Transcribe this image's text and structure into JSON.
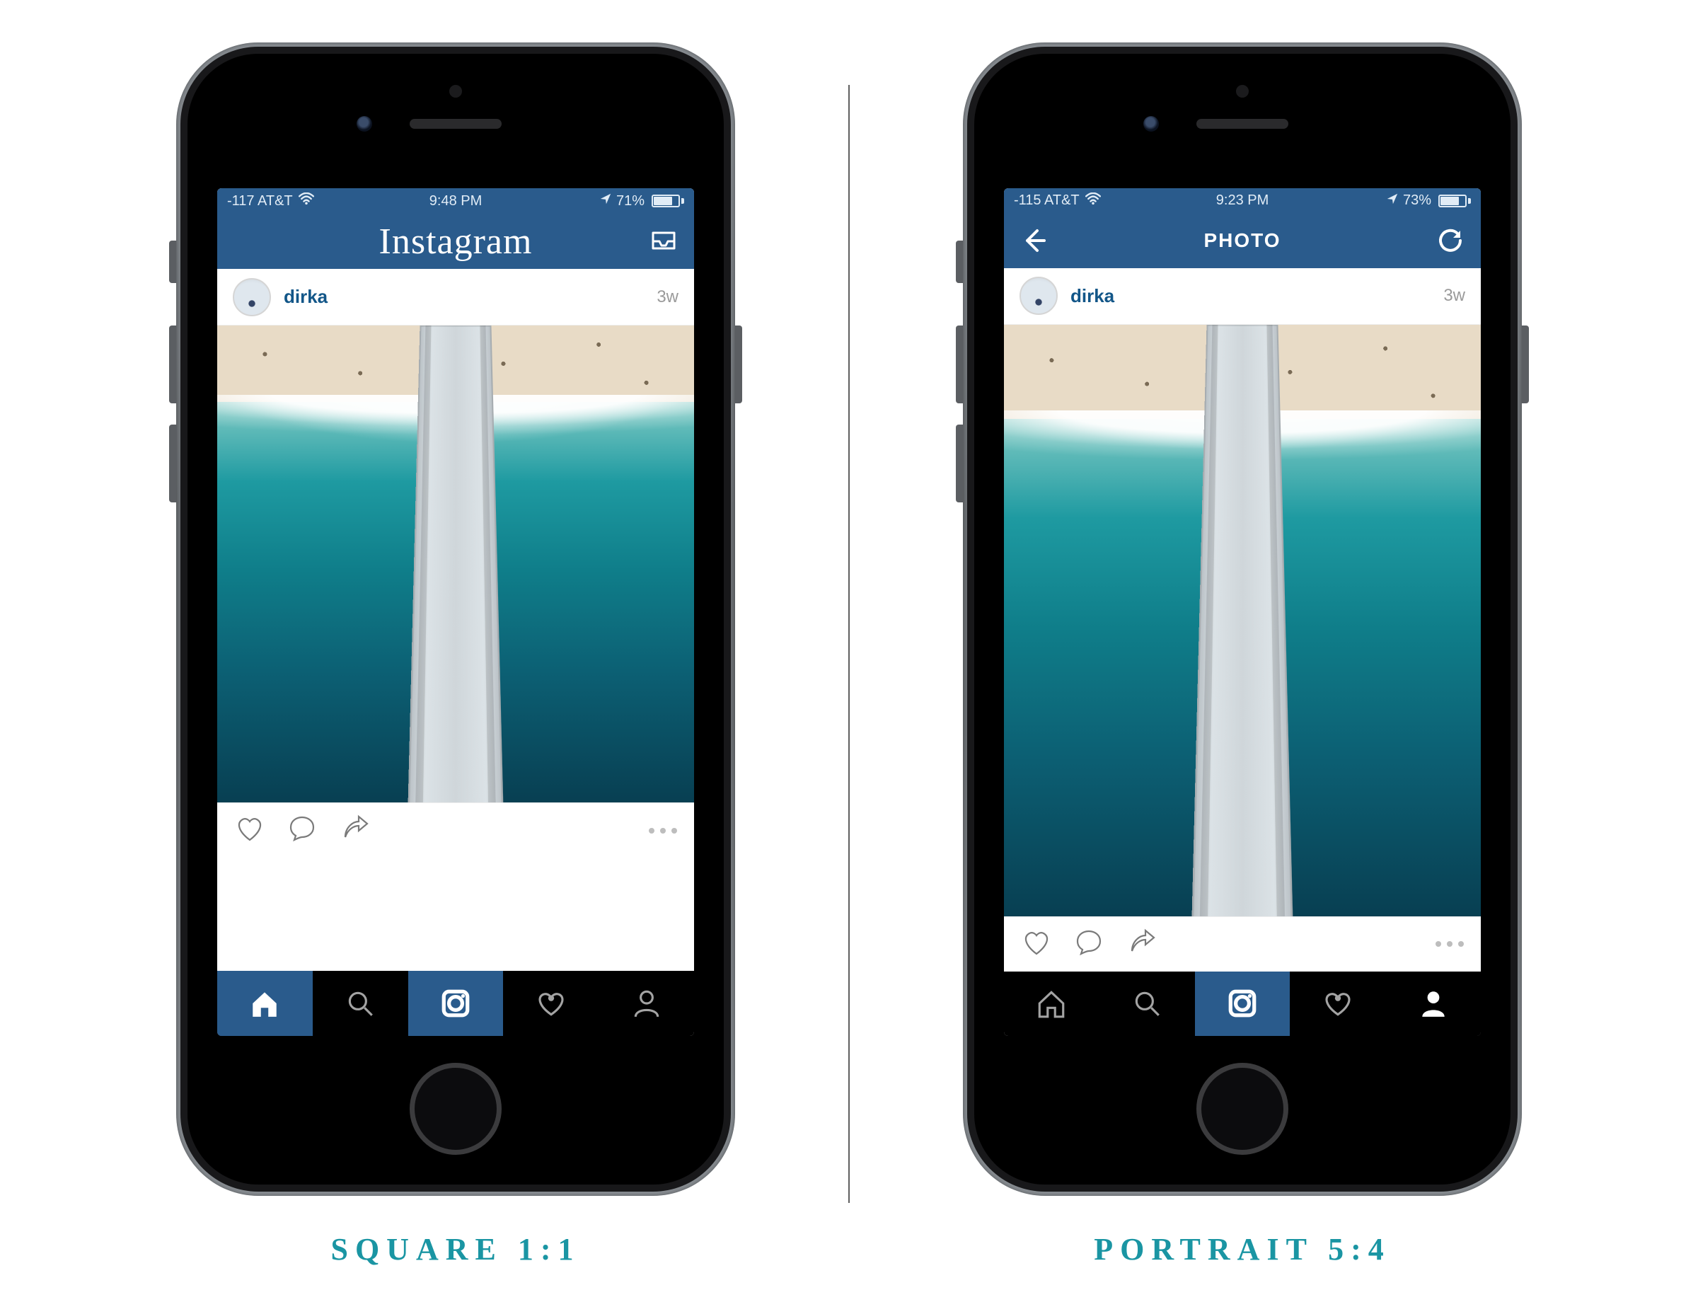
{
  "captions": {
    "left": "SQUARE 1:1",
    "right": "PORTRAIT 5:4"
  },
  "left": {
    "status": {
      "signal": "-117 AT&T",
      "time": "9:48 PM",
      "battery_pct": "71%",
      "battery_fill": 71
    },
    "header": {
      "type": "logo",
      "title": "Instagram"
    },
    "post": {
      "username": "dirka",
      "age": "3w",
      "aspect": "sq"
    }
  },
  "right": {
    "status": {
      "signal": "-115 AT&T",
      "time": "9:23 PM",
      "battery_pct": "73%",
      "battery_fill": 73
    },
    "header": {
      "type": "photo",
      "title": "PHOTO"
    },
    "post": {
      "username": "dirka",
      "age": "3w",
      "aspect": "pt"
    }
  },
  "tabs": {
    "left_active": 0,
    "right_active": 4
  }
}
